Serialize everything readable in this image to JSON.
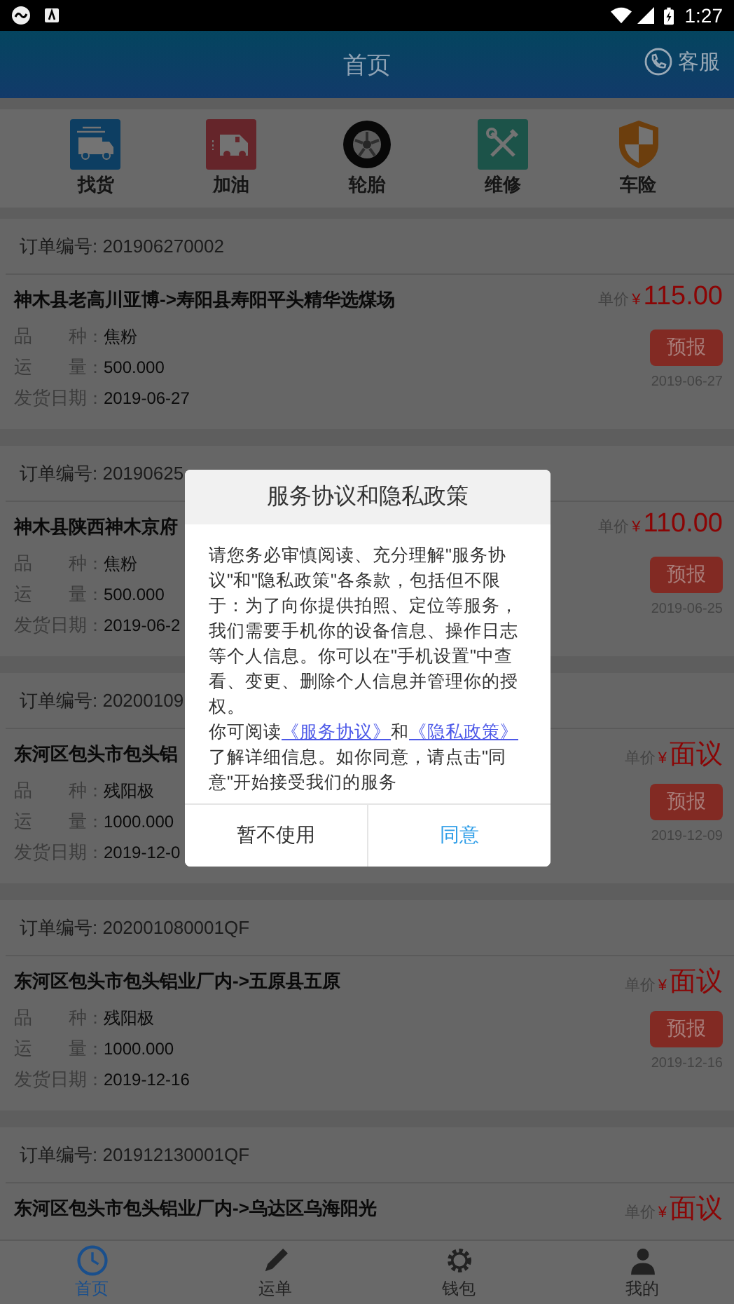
{
  "status_bar": {
    "time": "1:27"
  },
  "header": {
    "title": "首页",
    "service": "客服"
  },
  "shortcuts": [
    {
      "label": "找货",
      "kind": "truck"
    },
    {
      "label": "加油",
      "kind": "fuel"
    },
    {
      "label": "轮胎",
      "kind": "tire"
    },
    {
      "label": "维修",
      "kind": "repair"
    },
    {
      "label": "车险",
      "kind": "insurance"
    }
  ],
  "colon": "：",
  "orders": [
    {
      "order_label": "订单编号: 201906270002",
      "route": "神木县老高川亚博->寿阳县寿阳平头精华选煤场",
      "price_label": "单价",
      "currency": "¥",
      "price": "115.00",
      "details": [
        {
          "label": "品种",
          "value": "焦粉"
        },
        {
          "label": "运量",
          "value": "500.000"
        },
        {
          "label": "发货日期",
          "value": "2019-06-27"
        }
      ],
      "button": "预报",
      "date": "2019-06-27"
    },
    {
      "order_label": "订单编号: 20190625",
      "route": "神木县陕西神木京府",
      "price_label": "单价",
      "currency": "¥",
      "price": "110.00",
      "details": [
        {
          "label": "品种",
          "value": "焦粉"
        },
        {
          "label": "运量",
          "value": "500.000"
        },
        {
          "label": "发货日期",
          "value": "2019-06-2"
        }
      ],
      "button": "预报",
      "date": "2019-06-25"
    },
    {
      "order_label": "订单编号: 20200109",
      "route": "东河区包头市包头铝",
      "price_label": "单价",
      "currency": "¥",
      "price": "面议",
      "details": [
        {
          "label": "品种",
          "value": "残阳极"
        },
        {
          "label": "运量",
          "value": "1000.000"
        },
        {
          "label": "发货日期",
          "value": "2019-12-0"
        }
      ],
      "button": "预报",
      "date": "2019-12-09"
    },
    {
      "order_label": "订单编号: 202001080001QF",
      "route": "东河区包头市包头铝业厂内->五原县五原",
      "price_label": "单价",
      "currency": "¥",
      "price": "面议",
      "details": [
        {
          "label": "品种",
          "value": "残阳极"
        },
        {
          "label": "运量",
          "value": "1000.000"
        },
        {
          "label": "发货日期",
          "value": "2019-12-16"
        }
      ],
      "button": "预报",
      "date": "2019-12-16"
    },
    {
      "order_label": "订单编号: 201912130001QF",
      "route": "东河区包头市包头铝业厂内->乌达区乌海阳光",
      "price_label": "单价",
      "currency": "¥",
      "price": "面议"
    }
  ],
  "tabbar": [
    {
      "label": "首页",
      "kind": "home",
      "selected": true
    },
    {
      "label": "运单",
      "kind": "waybill",
      "selected": false
    },
    {
      "label": "钱包",
      "kind": "wallet",
      "selected": false
    },
    {
      "label": "我的",
      "kind": "profile",
      "selected": false
    }
  ],
  "dialog": {
    "title": "服务协议和隐私政策",
    "paragraph": "请您务必审慎阅读、充分理解\"服务协议\"和\"隐私政策\"各条款，包括但不限于：为了向你提供拍照、定位等服务，我们需要手机你的设备信息、操作日志等个人信息。你可以在\"手机设置\"中查看、变更、删除个人信息并管理你的授权。",
    "parts": [
      {
        "kind": "text",
        "text": "你可阅读"
      },
      {
        "kind": "link",
        "text": "《服务协议》"
      },
      {
        "kind": "text",
        "text": "和"
      },
      {
        "kind": "link",
        "text": "《隐私政策》"
      },
      {
        "kind": "text",
        "text": "了解详细信息。如你同意，请点击\"同意\"开始接受我们的服务"
      }
    ],
    "buttons": [
      {
        "label": "暂不使用",
        "kind": "cancel"
      },
      {
        "label": "同意",
        "kind": "confirm"
      }
    ]
  }
}
